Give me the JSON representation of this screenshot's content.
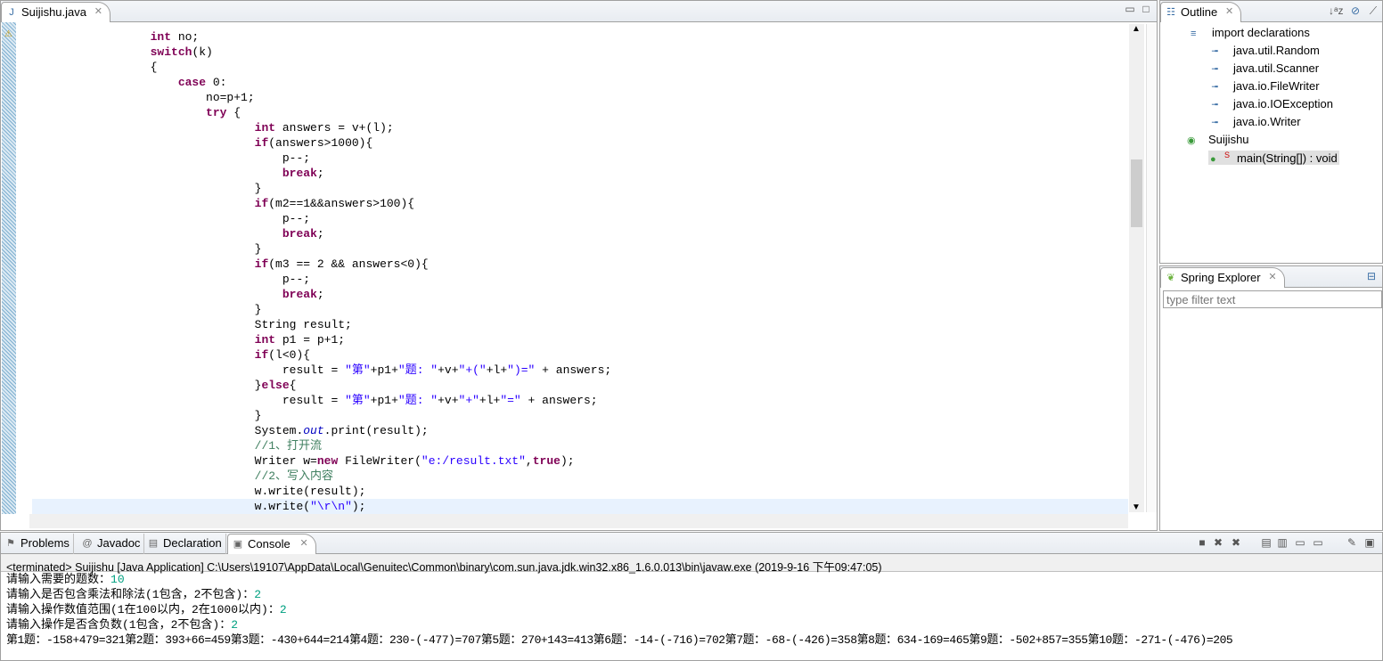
{
  "editor": {
    "tab_label": "Suijishu.java",
    "code_lines": [
      [
        [
          "n",
          "                 "
        ],
        [
          "k",
          "int"
        ],
        [
          "n",
          " no;"
        ]
      ],
      [
        [
          "n",
          "                 "
        ],
        [
          "k",
          "switch"
        ],
        [
          "n",
          "(k)"
        ]
      ],
      [
        [
          "n",
          "                 {"
        ]
      ],
      [
        [
          "n",
          "                     "
        ],
        [
          "k",
          "case"
        ],
        [
          "n",
          " 0:"
        ]
      ],
      [
        [
          "n",
          "                         no=p+1;"
        ]
      ],
      [
        [
          "n",
          "                         "
        ],
        [
          "k",
          "try"
        ],
        [
          "n",
          " {"
        ]
      ],
      [
        [
          "n",
          "                                "
        ],
        [
          "k",
          "int"
        ],
        [
          "n",
          " answers = v+(l);"
        ]
      ],
      [
        [
          "n",
          "                                "
        ],
        [
          "k",
          "if"
        ],
        [
          "n",
          "(answers>1000){"
        ]
      ],
      [
        [
          "n",
          "                                    p--;"
        ]
      ],
      [
        [
          "n",
          "                                    "
        ],
        [
          "k",
          "break"
        ],
        [
          "n",
          ";"
        ]
      ],
      [
        [
          "n",
          "                                }"
        ]
      ],
      [
        [
          "n",
          "                                "
        ],
        [
          "k",
          "if"
        ],
        [
          "n",
          "(m2==1&&answers>100){"
        ]
      ],
      [
        [
          "n",
          "                                    p--;"
        ]
      ],
      [
        [
          "n",
          "                                    "
        ],
        [
          "k",
          "break"
        ],
        [
          "n",
          ";"
        ]
      ],
      [
        [
          "n",
          "                                }"
        ]
      ],
      [
        [
          "n",
          "                                "
        ],
        [
          "k",
          "if"
        ],
        [
          "n",
          "(m3 == 2 && answers<0){"
        ]
      ],
      [
        [
          "n",
          "                                    p--;"
        ]
      ],
      [
        [
          "n",
          "                                    "
        ],
        [
          "k",
          "break"
        ],
        [
          "n",
          ";"
        ]
      ],
      [
        [
          "n",
          "                                }"
        ]
      ],
      [
        [
          "n",
          "                                String result;"
        ]
      ],
      [
        [
          "n",
          "                                "
        ],
        [
          "k",
          "int"
        ],
        [
          "n",
          " p1 = p+1;"
        ]
      ],
      [
        [
          "n",
          "                                "
        ],
        [
          "k",
          "if"
        ],
        [
          "n",
          "(l<0){"
        ]
      ],
      [
        [
          "n",
          "                                    result = "
        ],
        [
          "s",
          "\"第\""
        ],
        [
          "n",
          "+p1+"
        ],
        [
          "s",
          "\"题: \""
        ],
        [
          "n",
          "+v+"
        ],
        [
          "s",
          "\"+(\""
        ],
        [
          "n",
          "+l+"
        ],
        [
          "s",
          "\")=\""
        ],
        [
          "n",
          " + answers;"
        ]
      ],
      [
        [
          "n",
          "                                }"
        ],
        [
          "k",
          "else"
        ],
        [
          "n",
          "{"
        ]
      ],
      [
        [
          "n",
          "                                    result = "
        ],
        [
          "s",
          "\"第\""
        ],
        [
          "n",
          "+p1+"
        ],
        [
          "s",
          "\"题: \""
        ],
        [
          "n",
          "+v+"
        ],
        [
          "s",
          "\"+\""
        ],
        [
          "n",
          "+l+"
        ],
        [
          "s",
          "\"=\""
        ],
        [
          "n",
          " + answers;"
        ]
      ],
      [
        [
          "n",
          "                                }"
        ]
      ],
      [
        [
          "n",
          "                                System."
        ],
        [
          "f",
          "out"
        ],
        [
          "n",
          ".print(result);"
        ]
      ],
      [
        [
          "n",
          "                                "
        ],
        [
          "c",
          "//1、打开流"
        ]
      ],
      [
        [
          "n",
          "                                Writer w="
        ],
        [
          "k",
          "new"
        ],
        [
          "n",
          " FileWriter("
        ],
        [
          "s",
          "\"e:/result.txt\""
        ],
        [
          "n",
          ","
        ],
        [
          "k",
          "true"
        ],
        [
          "n",
          ");"
        ]
      ],
      [
        [
          "n",
          "                                "
        ],
        [
          "c",
          "//2、写入内容"
        ]
      ],
      [
        [
          "n",
          "                                w.write(result);"
        ]
      ],
      [
        [
          "n",
          "                                w.write("
        ],
        [
          "s",
          "\"\\r\\n\""
        ],
        [
          "n",
          ");"
        ]
      ]
    ]
  },
  "outline": {
    "tab_label": "Outline",
    "items": [
      {
        "label": "import declarations",
        "icon": "imports-icon"
      },
      {
        "label": "java.util.Random",
        "icon": "import-icon"
      },
      {
        "label": "java.util.Scanner",
        "icon": "import-icon"
      },
      {
        "label": "java.io.FileWriter",
        "icon": "import-icon"
      },
      {
        "label": "java.io.IOException",
        "icon": "import-icon"
      },
      {
        "label": "java.io.Writer",
        "icon": "import-icon"
      },
      {
        "label": "Suijishu",
        "icon": "class-icon"
      },
      {
        "label": "main(String[]) : void",
        "icon": "method-icon",
        "badge": "S"
      }
    ]
  },
  "spring": {
    "tab_label": "Spring Explorer",
    "filter_placeholder": "type filter text"
  },
  "bottom_tabs": [
    {
      "label": "Problems"
    },
    {
      "label": "Javadoc"
    },
    {
      "label": "Declaration"
    },
    {
      "label": "Console"
    }
  ],
  "console": {
    "header": "<terminated> Suijishu [Java Application] C:\\Users\\19107\\AppData\\Local\\Genuitec\\Common\\binary\\com.sun.java.jdk.win32.x86_1.6.0.013\\bin\\javaw.exe (2019-9-16 下午09:47:05)",
    "lines": [
      {
        "prompt": "请输入需要的题数：",
        "input": "10"
      },
      {
        "prompt": "请输入是否包含乘法和除法(1包含，2不包含)：",
        "input": "2"
      },
      {
        "prompt": "请输入操作数值范围(1在100以内，2在1000以内)：",
        "input": "2"
      },
      {
        "prompt": "请输入操作是否含负数(1包含，2不包含)：",
        "input": "2"
      }
    ],
    "output": "第1题：-158+479=321第2题：393+66=459第3题：-430+644=214第4题：230-(-477)=707第5题：270+143=413第6题：-14-(-716)=702第7题：-68-(-426)=358第8题：634-169=465第9题：-502+857=355第10题：-271-(-476)=205",
    "input_color": "#00a080"
  }
}
